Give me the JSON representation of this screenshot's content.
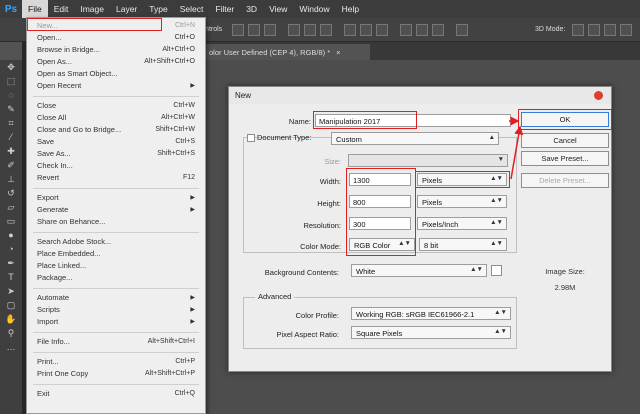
{
  "app": {
    "logo": "Ps"
  },
  "menubar": {
    "items": [
      "File",
      "Edit",
      "Image",
      "Layer",
      "Type",
      "Select",
      "Filter",
      "3D",
      "View",
      "Window",
      "Help"
    ]
  },
  "optbar": {
    "transform_label": "rm Controls",
    "mode_label": "3D Mode:"
  },
  "doctab": {
    "title": "olor User Defined (CEP 4), RGB/8) *",
    "close": "×"
  },
  "file_menu": {
    "items": [
      {
        "label": "New...",
        "shortcut": "Ctrl+N",
        "disabled": true
      },
      {
        "label": "Open...",
        "shortcut": "Ctrl+O"
      },
      {
        "label": "Browse in Bridge...",
        "shortcut": "Alt+Ctrl+O"
      },
      {
        "label": "Open As...",
        "shortcut": "Alt+Shift+Ctrl+O"
      },
      {
        "label": "Open as Smart Object...",
        "shortcut": ""
      },
      {
        "label": "Open Recent",
        "shortcut": "",
        "submenu": true
      },
      {
        "label": "Close",
        "shortcut": "Ctrl+W"
      },
      {
        "label": "Close All",
        "shortcut": "Alt+Ctrl+W"
      },
      {
        "label": "Close and Go to Bridge...",
        "shortcut": "Shift+Ctrl+W"
      },
      {
        "label": "Save",
        "shortcut": "Ctrl+S"
      },
      {
        "label": "Save As...",
        "shortcut": "Shift+Ctrl+S"
      },
      {
        "label": "Check In...",
        "shortcut": ""
      },
      {
        "label": "Revert",
        "shortcut": "F12"
      },
      {
        "label": "Export",
        "shortcut": "",
        "submenu": true
      },
      {
        "label": "Generate",
        "shortcut": "",
        "submenu": true
      },
      {
        "label": "Share on Behance...",
        "shortcut": ""
      },
      {
        "label": "Search Adobe Stock...",
        "shortcut": ""
      },
      {
        "label": "Place Embedded...",
        "shortcut": ""
      },
      {
        "label": "Place Linked...",
        "shortcut": ""
      },
      {
        "label": "Package...",
        "shortcut": ""
      },
      {
        "label": "Automate",
        "shortcut": "",
        "submenu": true
      },
      {
        "label": "Scripts",
        "shortcut": "",
        "submenu": true
      },
      {
        "label": "Import",
        "shortcut": "",
        "submenu": true
      },
      {
        "label": "File Info...",
        "shortcut": "Alt+Shift+Ctrl+I"
      },
      {
        "label": "Print...",
        "shortcut": "Ctrl+P"
      },
      {
        "label": "Print One Copy",
        "shortcut": "Alt+Shift+Ctrl+P"
      },
      {
        "label": "Exit",
        "shortcut": "Ctrl+Q"
      }
    ]
  },
  "dialog": {
    "title": "New",
    "name_label": "Name:",
    "name_value": "Manipulation 2017",
    "doc_type_label": "Document Type:",
    "doc_type_value": "Custom",
    "size_label": "Size:",
    "size_value": "",
    "width_label": "Width:",
    "width_value": "1300",
    "width_unit": "Pixels",
    "height_label": "Height:",
    "height_value": "800",
    "height_unit": "Pixels",
    "resolution_label": "Resolution:",
    "resolution_value": "300",
    "resolution_unit": "Pixels/Inch",
    "color_mode_label": "Color Mode:",
    "color_mode_value": "RGB Color",
    "bit_depth_value": "8 bit",
    "bg_label": "Background Contents:",
    "bg_value": "White",
    "advanced_label": "Advanced",
    "color_profile_label": "Color Profile:",
    "color_profile_value": "Working RGB:  sRGB IEC61966-2.1",
    "pixel_aspect_label": "Pixel Aspect Ratio:",
    "pixel_aspect_value": "Square Pixels",
    "ok_label": "OK",
    "cancel_label": "Cancel",
    "save_preset_label": "Save Preset...",
    "delete_preset_label": "Delete Preset...",
    "image_size_label": "Image Size:",
    "image_size_value": "2.98M"
  },
  "colors": {
    "highlight": "#e02020",
    "ps_blue": "#31a8ff"
  }
}
